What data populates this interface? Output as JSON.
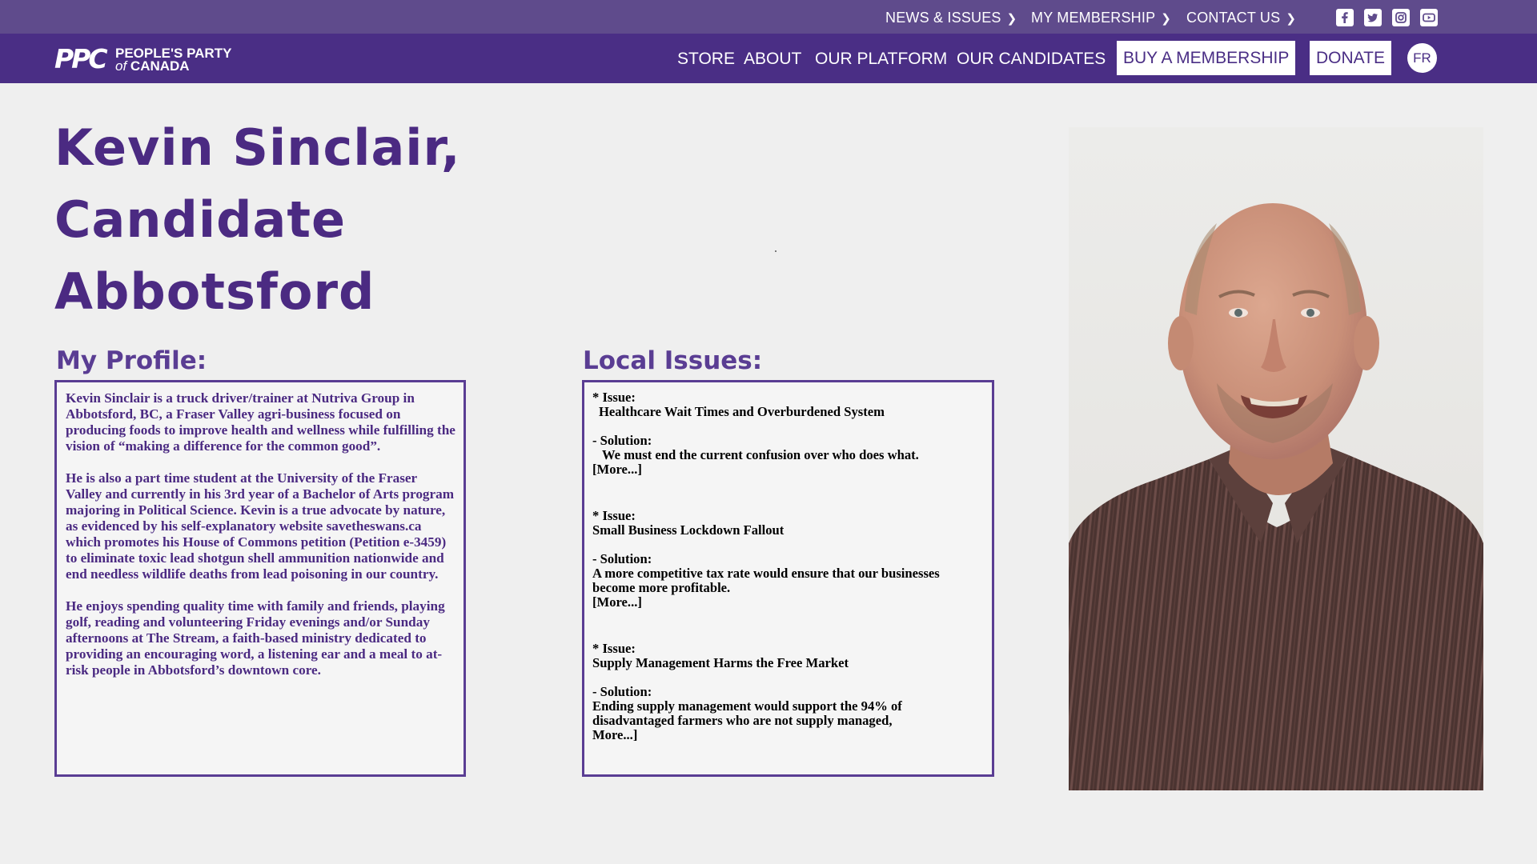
{
  "topbar": {
    "links": [
      "NEWS & ISSUES",
      "MY MEMBERSHIP",
      "CONTACT US"
    ],
    "social": [
      "facebook-icon",
      "twitter-icon",
      "instagram-icon",
      "youtube-icon"
    ]
  },
  "brand": {
    "mark": "PPC",
    "line1": "PEOPLE'S PARTY",
    "line2_italic": "of",
    "line2": "CANADA"
  },
  "nav": {
    "items": [
      "STORE",
      "ABOUT",
      "OUR PLATFORM",
      "OUR CANDIDATES"
    ],
    "membership_button": "BUY A MEMBERSHIP",
    "donate_button": "DONATE",
    "language_button": "FR"
  },
  "candidate": {
    "title_line1": "Kevin Sinclair,",
    "title_line2": "Candidate",
    "title_line3": "Abbotsford"
  },
  "profile": {
    "heading": "My Profile:",
    "paragraphs": [
      "Kevin Sinclair is a truck driver/trainer at Nutriva Group in Abbotsford, BC, a Fraser Valley agri-business focused on producing foods to improve health and wellness while fulfilling the vision of “making a difference for the common good”.",
      "He is also a part time student at the University of the Fraser Valley and currently in his 3rd year of a Bachelor of Arts program majoring in Political Science. Kevin is a true advocate by nature, as evidenced by his self-explanatory website savetheswans.ca which promotes his House of Commons petition (Petition e-3459) to eliminate toxic lead shotgun shell ammunition nationwide and end needless wildlife deaths from lead poisoning in our country.",
      "He enjoys spending quality time with family and friends, playing golf, reading and volunteering Friday evenings and/or Sunday afternoons at The Stream, a faith-based ministry dedicated to providing an encouraging word, a listening ear and a meal to at-risk people in Abbotsford’s downtown core."
    ]
  },
  "issues": {
    "heading": "Local Issues:",
    "list": [
      {
        "issue_label": "* Issue:",
        "issue": "Healthcare Wait Times and Overburdened System",
        "solution_label": " - Solution:",
        "solution": "We must end the current confusion over who does what.",
        "more": "[More...]"
      },
      {
        "issue_label": "* Issue:",
        "issue": "Small Business Lockdown Fallout",
        "solution_label": " - Solution:",
        "solution": "A more competitive tax rate would ensure that our businesses become more profitable.",
        "more": "[More...]"
      },
      {
        "issue_label": "* Issue:",
        "issue": "Supply Management Harms the Free Market",
        "solution_label": " - Solution:",
        "solution": "Ending supply management would support the 94% of disadvantaged farmers who are not supply managed,",
        "more": "More...]"
      }
    ]
  },
  "colors": {
    "topbar": "#5f4b8c",
    "navbar": "#4a2e85",
    "heading": "#4b2a82",
    "page_bg": "#efefef"
  }
}
